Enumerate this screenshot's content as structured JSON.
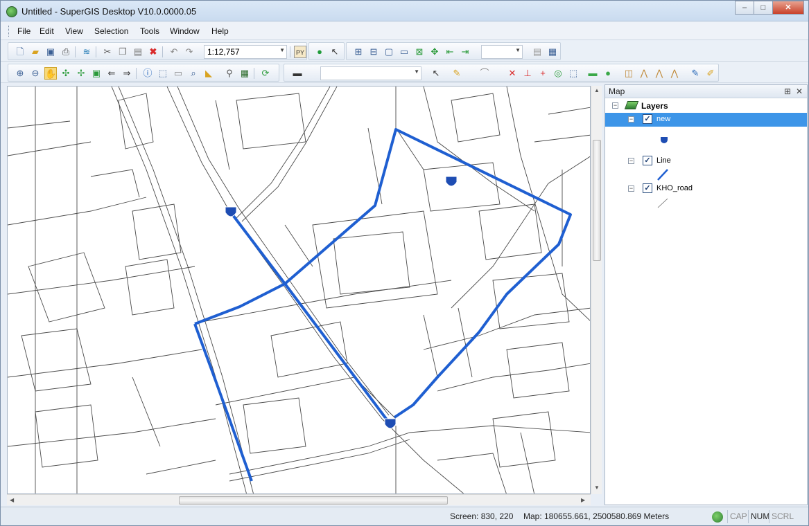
{
  "window": {
    "title": "Untitled - SuperGIS Desktop V10.0.0000.05",
    "minimize": "–",
    "maximize": "□",
    "close": "✕"
  },
  "menu": [
    "File",
    "Edit",
    "View",
    "Selection",
    "Tools",
    "Window",
    "Help"
  ],
  "toolbar": {
    "scale": "1:12,757",
    "standard_icons": [
      "new-icon",
      "open-icon",
      "save-icon",
      "print-icon",
      "add-layer-icon",
      "cut-icon",
      "copy-icon",
      "paste-icon",
      "delete-icon",
      "undo-icon",
      "redo-icon",
      "python-icon",
      "help-icon",
      "whats-this-icon"
    ],
    "nav_icons": [
      "zoom-in-icon",
      "zoom-out-icon",
      "pan-icon",
      "full-extent-icon",
      "fixed-zoom-icon",
      "zoom-layer-icon",
      "back-icon",
      "forward-icon",
      "identify-icon",
      "select-icon",
      "hyperlink-icon",
      "measure-icon",
      "edit-tool-icon",
      "refresh-icon"
    ]
  },
  "map": {
    "road_color": "#4a4a4a",
    "highlight_color": "#1f5fd1",
    "marker_color": "#1e4db3"
  },
  "panel": {
    "title": "Map",
    "pin": "⊞",
    "close": "✕",
    "root_label": "Layers",
    "layers": [
      {
        "name": "new",
        "checked": true,
        "selected": true,
        "symbol": "point"
      },
      {
        "name": "Line",
        "checked": true,
        "selected": false,
        "symbol": "line"
      },
      {
        "name": "KHO_road",
        "checked": true,
        "selected": false,
        "symbol": "thin-line"
      }
    ]
  },
  "status": {
    "screen": "Screen: 830, 220",
    "map": "Map: 180655.661, 2500580.869 Meters",
    "cap": "CAP",
    "num": "NUM",
    "scrl": "SCRL"
  }
}
